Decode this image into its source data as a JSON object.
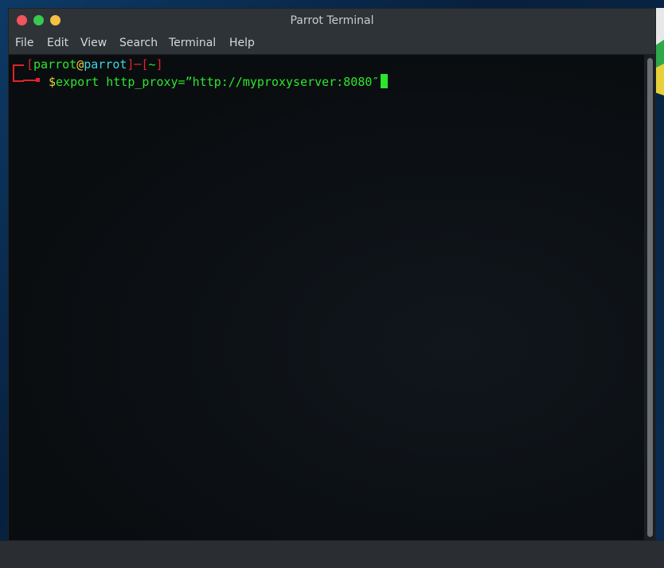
{
  "window": {
    "title": "Parrot Terminal"
  },
  "menu": [
    "File",
    "Edit",
    "View",
    "Search",
    "Terminal",
    "Help"
  ],
  "prompt": {
    "open_bracket": "[",
    "user": "parrot",
    "at": "@",
    "host": "parrot",
    "close_bracket": "]",
    "separator": "─",
    "dir_open": "[",
    "dir": "~",
    "dir_close": "]",
    "dollar": "$",
    "command": "export http_proxy=”http://myproxyserver:8080″"
  },
  "colors": {
    "prompt_red": "#e0242a",
    "text_green": "#2ce62c",
    "host_cyan": "#3dd6df",
    "dollar_yellow": "#e8d03a"
  }
}
